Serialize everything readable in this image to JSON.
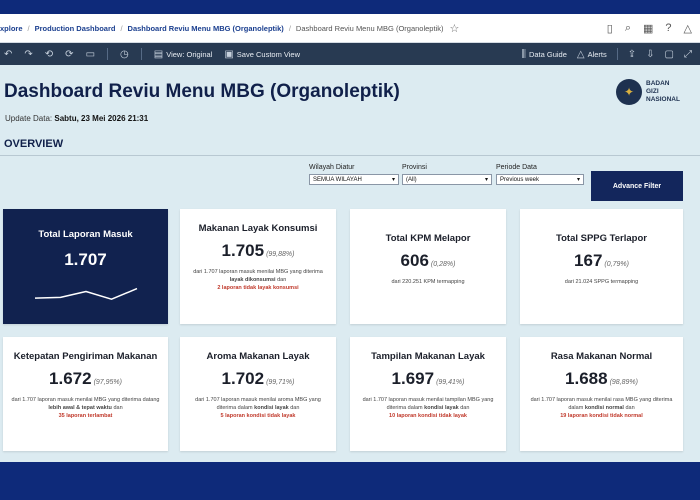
{
  "breadcrumb": {
    "items": [
      "xplore",
      "Production Dashboard",
      "Dashboard Reviu Menu MBG (Organoleptik)",
      "Dashboard Reviu Menu MBG (Organoleptik)"
    ]
  },
  "toolbar": {
    "view_original": "View: Original",
    "save_custom_view": "Save Custom View",
    "data_guide": "Data Guide",
    "alerts": "Alerts"
  },
  "header": {
    "title": "Dashboard Reviu Menu MBG (Organoleptik)",
    "update_label": "Update Data:",
    "update_value": "Sabtu, 23 Mei 2026 21:31",
    "logo_lines": [
      "BADAN",
      "GIZI",
      "NASIONAL"
    ]
  },
  "section": {
    "overview": "OVERVIEW"
  },
  "filters": [
    {
      "label": "Wilayah Diatur",
      "value": "SEMUA WILAYAH"
    },
    {
      "label": "Provinsi",
      "value": "(All)"
    },
    {
      "label": "Periode Data",
      "value": "Previous week"
    }
  ],
  "advance_filter": "Advance Filter",
  "cards_row1": [
    {
      "title": "Total Laporan Masuk",
      "value": "1.707",
      "pct": "",
      "desc_prefix": "",
      "desc_bold": "",
      "desc_suffix": "",
      "alert": ""
    },
    {
      "title": "Makanan Layak Konsumsi",
      "value": "1.705",
      "pct": "(99,88%)",
      "desc_prefix": "dari 1.707 laporan masuk menilai MBG yang diterima",
      "desc_bold": "layak dikonsumsi",
      "desc_suffix": "dan",
      "alert": "2 laporan tidak layak konsumsi"
    },
    {
      "title": "Total KPM Melapor",
      "value": "606",
      "pct": "(0,28%)",
      "desc_prefix": "dari 220.251 KPM termapping",
      "desc_bold": "",
      "desc_suffix": "",
      "alert": ""
    },
    {
      "title": "Total SPPG Terlapor",
      "value": "167",
      "pct": "(0,79%)",
      "desc_prefix": "dari 21.024 SPPG termapping",
      "desc_bold": "",
      "desc_suffix": "",
      "alert": ""
    }
  ],
  "cards_row2": [
    {
      "title": "Ketepatan Pengiriman Makanan",
      "value": "1.672",
      "pct": "(97,95%)",
      "desc_prefix": "dari 1.707 laporan masuk menilai MBG yang diterima datang",
      "desc_bold": "lebih awal & tepat waktu",
      "desc_suffix": "dan",
      "alert": "35 laporan terlambat"
    },
    {
      "title": "Aroma Makanan Layak",
      "value": "1.702",
      "pct": "(99,71%)",
      "desc_prefix": "dari 1.707 laporan masuk menilai aroma MBG yang diterima dalam",
      "desc_bold": "kondisi layak",
      "desc_suffix": "dan",
      "alert": "5 laporan kondisi tidak layak"
    },
    {
      "title": "Tampilan Makanan Layak",
      "value": "1.697",
      "pct": "(99,41%)",
      "desc_prefix": "dari 1.707 laporan masuk menilai tampilan MBG yang diterima dalam",
      "desc_bold": "kondisi layak",
      "desc_suffix": "dan",
      "alert": "10 laporan kondisi tidak layak"
    },
    {
      "title": "Rasa Makanan Normal",
      "value": "1.688",
      "pct": "(98,89%)",
      "desc_prefix": "dari 1.707 laporan masuk menilai rasa MBG yang diterima dalam",
      "desc_bold": "kondisi normal",
      "desc_suffix": "dan",
      "alert": "19 laporan kondisi tidak normal"
    }
  ],
  "sparkline": [
    0.55,
    0.52,
    0.25,
    0.6,
    0.12
  ],
  "colors": {
    "navy": "#11224f",
    "alert": "#c0392b",
    "toolbar": "#283a52",
    "page_bg": "#dcebf1"
  }
}
